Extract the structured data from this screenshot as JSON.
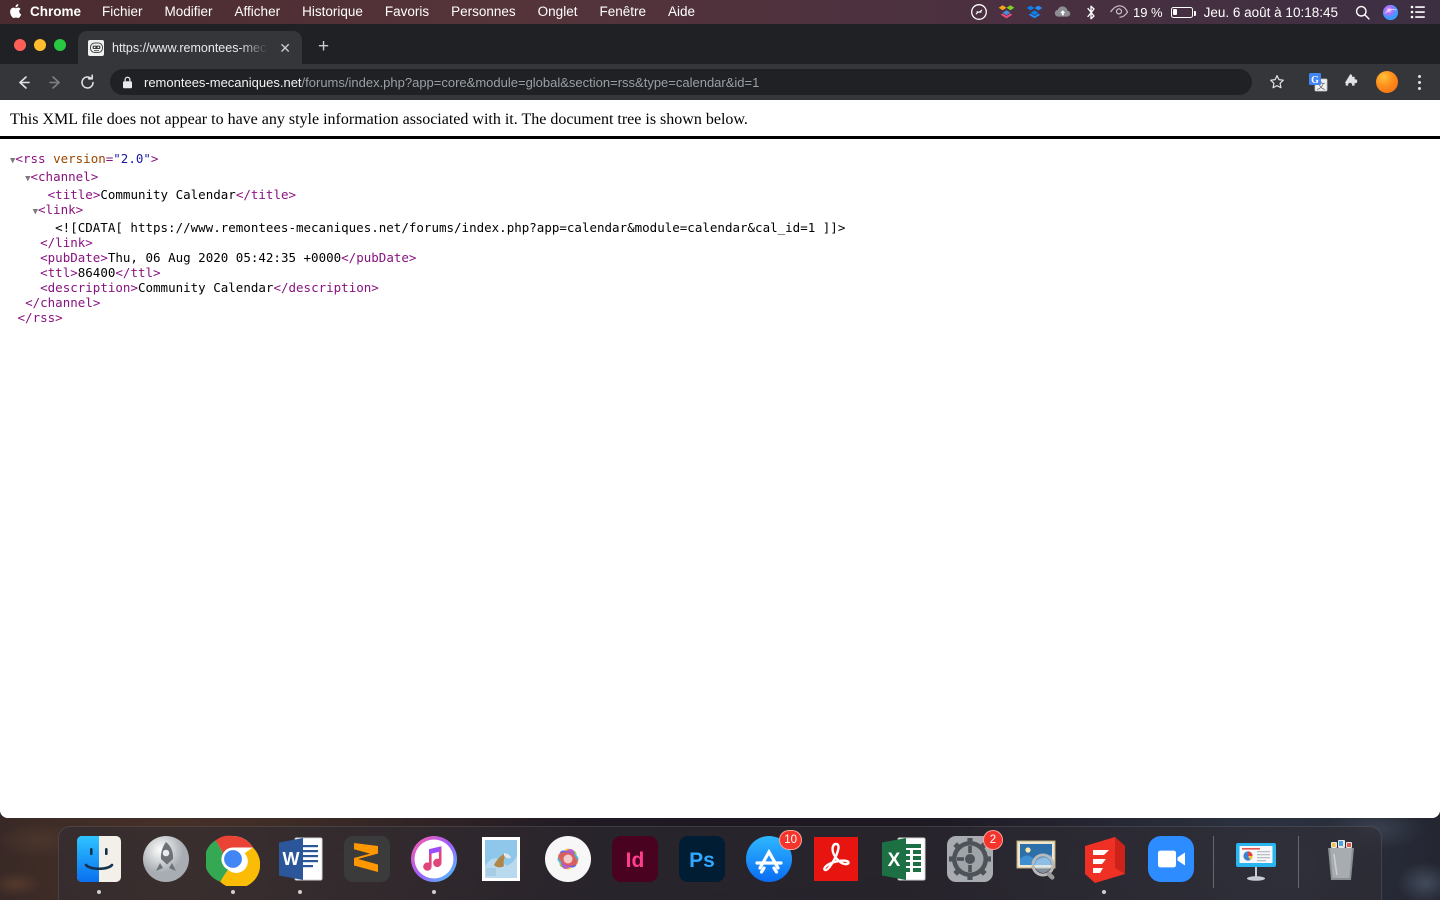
{
  "menubar": {
    "apple_icon": "apple-logo",
    "items": [
      {
        "label": "Chrome",
        "bold": true
      },
      {
        "label": "Fichier",
        "bold": false
      },
      {
        "label": "Modifier",
        "bold": false
      },
      {
        "label": "Afficher",
        "bold": false
      },
      {
        "label": "Historique",
        "bold": false
      },
      {
        "label": "Favoris",
        "bold": false
      },
      {
        "label": "Personnes",
        "bold": false
      },
      {
        "label": "Onglet",
        "bold": false
      },
      {
        "label": "Fenêtre",
        "bold": false
      },
      {
        "label": "Aide",
        "bold": false
      }
    ],
    "status_icons": [
      "shazam-icon",
      "dropbox-team-icon",
      "dropbox-icon",
      "cloud-upload-icon",
      "bluetooth-icon",
      "eye-icon"
    ],
    "battery_percent": "19 %",
    "clock": "Jeu. 6 août à  10:18:45",
    "right_icons": [
      "search-icon",
      "siri-icon",
      "control-center-icon"
    ]
  },
  "browser": {
    "tab": {
      "title": "https://www.remontees-mecan",
      "favicon": "robot-favicon",
      "close_label": "✕"
    },
    "newtab_label": "+",
    "toolbar": {
      "back_icon": "back-arrow-icon",
      "forward_icon": "forward-arrow-icon",
      "reload_icon": "reload-icon",
      "lock_icon": "lock-icon",
      "url_host": "remontees-mecaniques.net",
      "url_path": "/forums/index.php?app=core&module=global&section=rss&type=calendar&id=1",
      "star_icon": "star-bookmark-icon",
      "translate_icon": "google-translate-icon",
      "extensions_icon": "puzzle-piece-icon",
      "profile_icon": "profile-avatar-icon",
      "menu_icon": "three-dot-menu-icon"
    }
  },
  "page": {
    "notice": "This XML file does not appear to have any style information associated with it. The document tree is shown below.",
    "xml": {
      "root_tag": "rss",
      "root_attr_name": "version",
      "root_attr_value": "\"2.0\"",
      "channel_tag": "channel",
      "title_tag": "title",
      "title_text": "Community Calendar",
      "link_tag": "link",
      "cdata_text": "<![CDATA[ https://www.remontees-mecaniques.net/forums/index.php?app=calendar&module=calendar&cal_id=1 ]]>",
      "pubdate_tag": "pubDate",
      "pubdate_text": "Thu, 06 Aug 2020 05:42:35 +0000",
      "ttl_tag": "ttl",
      "ttl_text": "86400",
      "description_tag": "description",
      "description_text": "Community Calendar"
    }
  },
  "dock": {
    "items": [
      {
        "name": "finder",
        "running": true,
        "badge": null
      },
      {
        "name": "launchpad",
        "running": false,
        "badge": null
      },
      {
        "name": "google-chrome",
        "running": true,
        "badge": null
      },
      {
        "name": "microsoft-word",
        "running": true,
        "badge": null
      },
      {
        "name": "sublime-text",
        "running": false,
        "badge": null
      },
      {
        "name": "itunes",
        "running": true,
        "badge": null
      },
      {
        "name": "mail",
        "running": false,
        "badge": null
      },
      {
        "name": "photos",
        "running": false,
        "badge": null
      },
      {
        "name": "adobe-indesign",
        "running": false,
        "badge": null
      },
      {
        "name": "adobe-photoshop",
        "running": false,
        "badge": null
      },
      {
        "name": "app-store",
        "running": false,
        "badge": "10"
      },
      {
        "name": "adobe-acrobat",
        "running": false,
        "badge": null
      },
      {
        "name": "microsoft-excel",
        "running": false,
        "badge": null
      },
      {
        "name": "system-preferences",
        "running": false,
        "badge": "2"
      },
      {
        "name": "preview",
        "running": false,
        "badge": null
      },
      {
        "name": "sketchup",
        "running": true,
        "badge": null
      },
      {
        "name": "zoom",
        "running": false,
        "badge": null
      },
      {
        "name": "keynote-stand",
        "running": false,
        "badge": null
      },
      {
        "name": "trash",
        "running": false,
        "badge": null
      }
    ]
  }
}
